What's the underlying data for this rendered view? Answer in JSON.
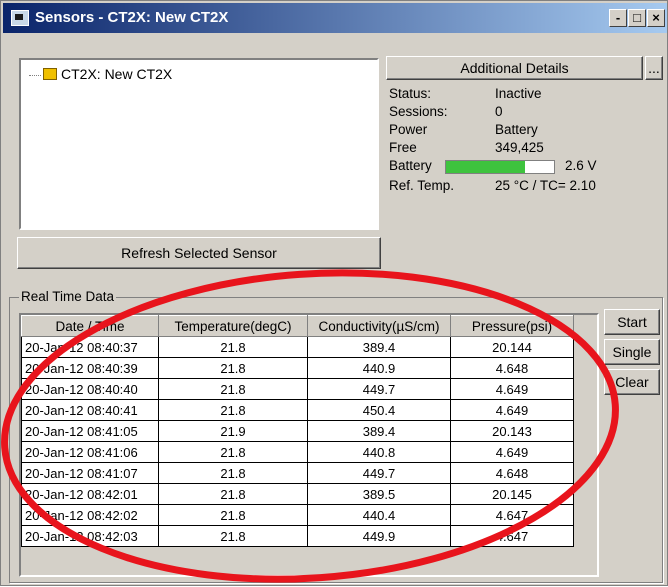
{
  "window": {
    "title": "Sensors - CT2X: New CT2X",
    "controls": {
      "minimize": "-",
      "maximize": "□",
      "close": "×"
    }
  },
  "tree": {
    "item_label": "CT2X: New CT2X"
  },
  "buttons": {
    "refresh": "Refresh Selected Sensor",
    "additional_details": "Additional Details",
    "details_more": "...",
    "start": "Start",
    "single": "Single",
    "clear": "Clear"
  },
  "details": {
    "status_label": "Status:",
    "status_value": "Inactive",
    "sessions_label": "Sessions:",
    "sessions_value": "0",
    "power_label": "Power",
    "power_value": "Battery",
    "free_label": "Free",
    "free_value": "349,425",
    "battery_label": "Battery",
    "battery_voltage": "2.6 V",
    "battery_level": 0.73,
    "reftemp_label": "Ref. Temp.",
    "reftemp_value": "25 °C / TC= 2.10"
  },
  "realtime": {
    "group_label": "Real Time Data",
    "columns": [
      "Date / Time",
      "Temperature(degC)",
      "Conductivity(µS/cm)",
      "Pressure(psi)"
    ],
    "rows": [
      [
        "20-Jan-12 08:40:37",
        "21.8",
        "389.4",
        "20.144"
      ],
      [
        "20-Jan-12 08:40:39",
        "21.8",
        "440.9",
        "4.648"
      ],
      [
        "20-Jan-12 08:40:40",
        "21.8",
        "449.7",
        "4.649"
      ],
      [
        "20-Jan-12 08:40:41",
        "21.8",
        "450.4",
        "4.649"
      ],
      [
        "20-Jan-12 08:41:05",
        "21.9",
        "389.4",
        "20.143"
      ],
      [
        "20-Jan-12 08:41:06",
        "21.8",
        "440.8",
        "4.649"
      ],
      [
        "20-Jan-12 08:41:07",
        "21.8",
        "449.7",
        "4.648"
      ],
      [
        "20-Jan-12 08:42:01",
        "21.8",
        "389.5",
        "20.145"
      ],
      [
        "20-Jan-12 08:42:02",
        "21.8",
        "440.4",
        "4.647"
      ],
      [
        "20-Jan-12 08:42:03",
        "21.8",
        "449.9",
        "4.647"
      ]
    ]
  },
  "colors": {
    "annotation": "#e8141c",
    "battery": "#3ec33e"
  }
}
